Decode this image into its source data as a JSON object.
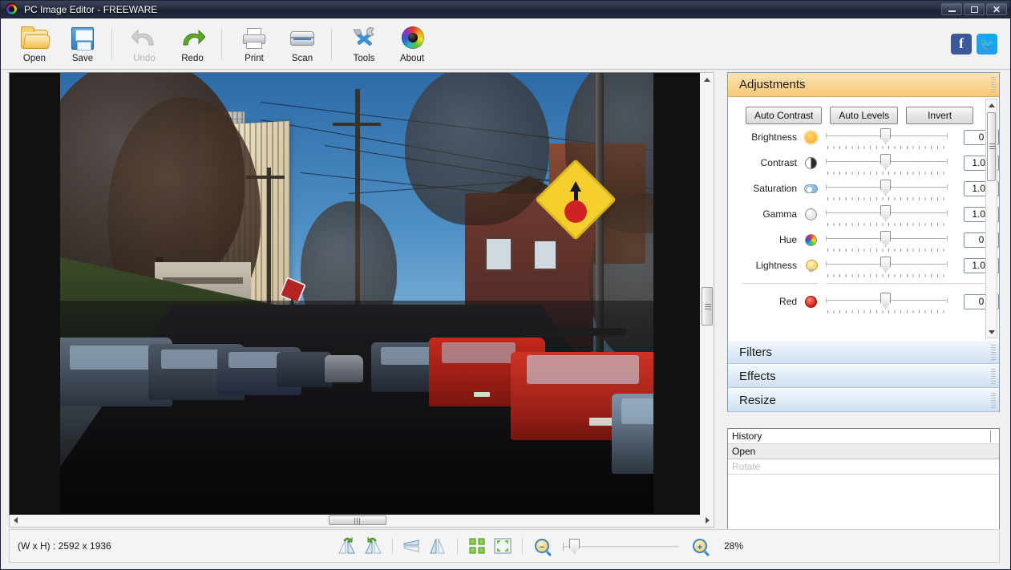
{
  "window": {
    "title": "PC Image Editor - FREEWARE",
    "logo_icon": "color-wheel-icon",
    "controls": {
      "minimize": "minimize-icon",
      "maximize": "maximize-icon",
      "close": "close-icon"
    }
  },
  "toolbar": {
    "items": [
      {
        "label": "Open",
        "icon": "folder-open-icon",
        "disabled": false
      },
      {
        "label": "Save",
        "icon": "floppy-disk-icon",
        "disabled": false
      },
      {
        "label": "Undo",
        "icon": "undo-arrow-icon",
        "disabled": true
      },
      {
        "label": "Redo",
        "icon": "redo-arrow-icon",
        "disabled": false
      },
      {
        "label": "Print",
        "icon": "printer-icon",
        "disabled": false
      },
      {
        "label": "Scan",
        "icon": "scanner-icon",
        "disabled": false
      },
      {
        "label": "Tools",
        "icon": "hammer-wrench-icon",
        "disabled": false
      },
      {
        "label": "About",
        "icon": "color-wheel-icon",
        "disabled": false
      }
    ],
    "social": [
      {
        "name": "facebook-icon",
        "glyph": "f",
        "color": "#3b5998"
      },
      {
        "name": "twitter-icon",
        "glyph": "🐦",
        "color": "#1da1f2"
      }
    ]
  },
  "panel": {
    "sections": [
      {
        "title": "Adjustments",
        "state": "expanded"
      },
      {
        "title": "Filters",
        "state": "collapsed"
      },
      {
        "title": "Effects",
        "state": "collapsed"
      },
      {
        "title": "Resize",
        "state": "collapsed"
      }
    ],
    "auto_buttons": [
      {
        "label": "Auto Contrast"
      },
      {
        "label": "Auto Levels"
      },
      {
        "label": "Invert"
      }
    ],
    "sliders": [
      {
        "label": "Brightness",
        "icon": "sun-icon",
        "value": "0",
        "pos": 68
      },
      {
        "label": "Contrast",
        "icon": "contrast-icon",
        "value": "1.00",
        "pos": 68
      },
      {
        "label": "Saturation",
        "icon": "saturation-icon",
        "value": "1.00",
        "pos": 68
      },
      {
        "label": "Gamma",
        "icon": "gamma-icon",
        "value": "1.00",
        "pos": 68
      },
      {
        "label": "Hue",
        "icon": "hue-wheel-icon",
        "value": "0",
        "pos": 68
      },
      {
        "label": "Lightness",
        "icon": "bulb-icon",
        "value": "1.00",
        "pos": 68
      },
      {
        "label": "Red",
        "icon": "red-channel-icon",
        "value": "0",
        "pos": 68
      }
    ]
  },
  "history": {
    "header": "History",
    "rows": [
      {
        "label": "Open",
        "state": "selected"
      },
      {
        "label": "Rotate",
        "state": "dimmed"
      }
    ]
  },
  "statusbar": {
    "dimensions_label": "(W x H) : 2592 x 1936",
    "zoom_percent": "28%",
    "tools": [
      {
        "name": "rotate-left-icon"
      },
      {
        "name": "rotate-right-icon"
      },
      {
        "name": "flip-vertical-icon"
      },
      {
        "name": "flip-horizontal-icon"
      },
      {
        "name": "crop-icon"
      },
      {
        "name": "fit-to-screen-icon"
      },
      {
        "name": "zoom-out-icon"
      },
      {
        "name": "zoom-in-icon"
      }
    ]
  },
  "colors": {
    "titlebar": "#2a3146",
    "accent_active": "#f8c87a",
    "accent_collapsed": "#cfe0f2",
    "panel_border": "#7f9bc0"
  }
}
